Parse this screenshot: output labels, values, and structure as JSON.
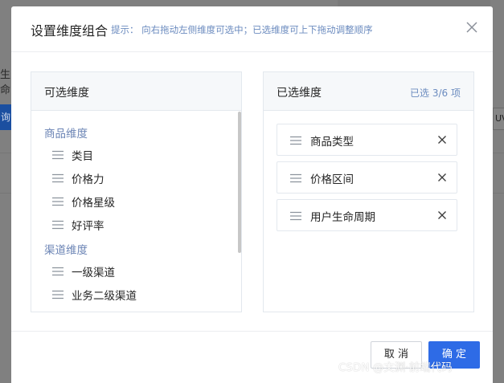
{
  "background": {
    "left_text": "生命",
    "left_button": "询",
    "right_box": "UV"
  },
  "modal": {
    "title": "设置维度组合",
    "tip": "提示： 向右拖动左侧维度可选中；已选维度可上下拖动调整顺序",
    "close_icon": "close-icon"
  },
  "available": {
    "title": "可选维度",
    "groups": [
      {
        "name": "商品维度",
        "items": [
          "类目",
          "价格力",
          "价格星级",
          "好评率"
        ]
      },
      {
        "name": "渠道维度",
        "items": [
          "一级渠道",
          "业务二级渠道"
        ]
      }
    ]
  },
  "selected": {
    "title": "已选维度",
    "count": "已选 3/6 项",
    "items": [
      "商品类型",
      "价格区间",
      "用户生命周期"
    ]
  },
  "footer": {
    "cancel_label": "取 消",
    "ok_label": "确 定"
  },
  "watermark": "CSDN @文渊·前端代码",
  "colors": {
    "accent": "#2e6be6",
    "tip": "#6b8bbf",
    "group": "#6b84b5"
  }
}
